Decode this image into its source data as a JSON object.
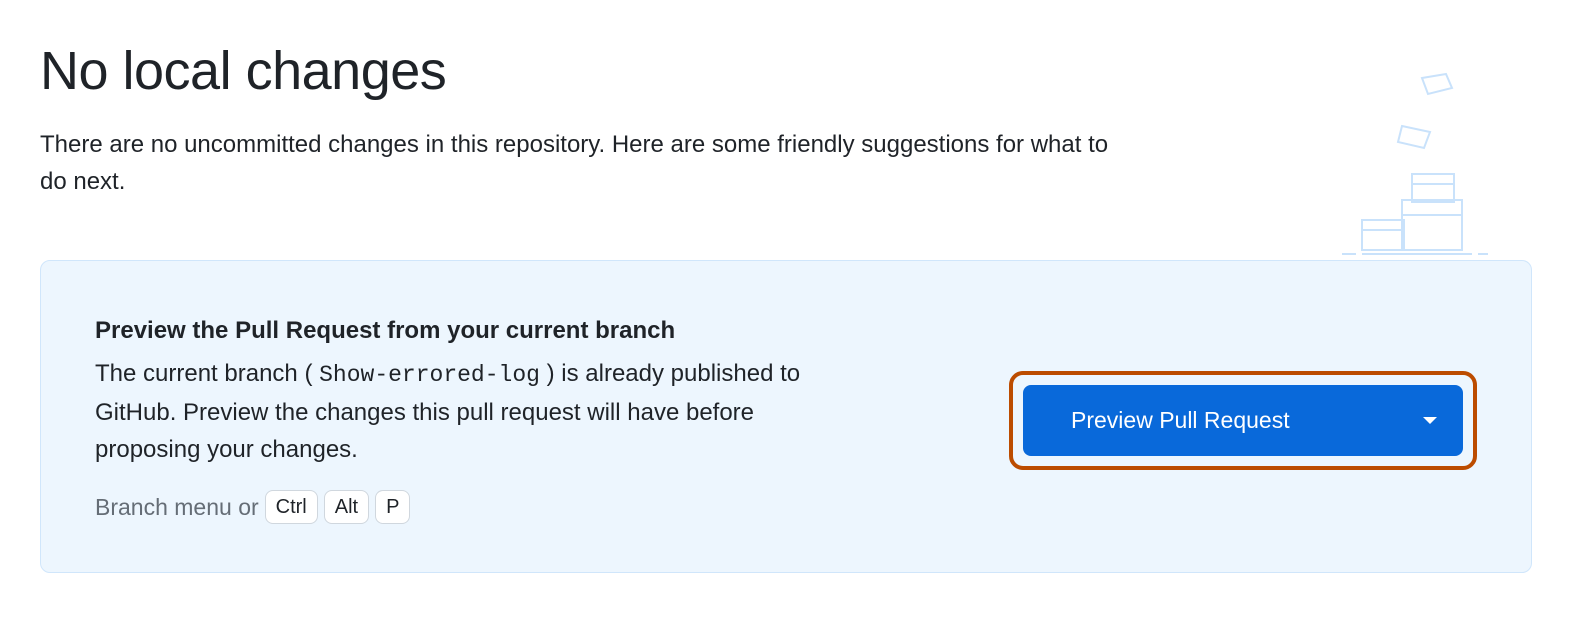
{
  "page": {
    "title": "No local changes",
    "subtitle": "There are no uncommitted changes in this repository. Here are some friendly suggestions for what to do next."
  },
  "card": {
    "title": "Preview the Pull Request from your current branch",
    "body_prefix": "The current branch (",
    "branch_name": "Show-errored-log",
    "body_suffix": ") is already published to GitHub. Preview the changes this pull request will have before proposing your changes.",
    "meta_prefix": "Branch menu or",
    "shortcut_keys": [
      "Ctrl",
      "Alt",
      "P"
    ],
    "button_label": "Preview Pull Request"
  },
  "colors": {
    "accent": "#0969da",
    "highlight_border": "#bc4c00",
    "card_bg": "#edf6fe",
    "card_border": "#d0e6fb",
    "decoration": "#c9e2fb"
  }
}
